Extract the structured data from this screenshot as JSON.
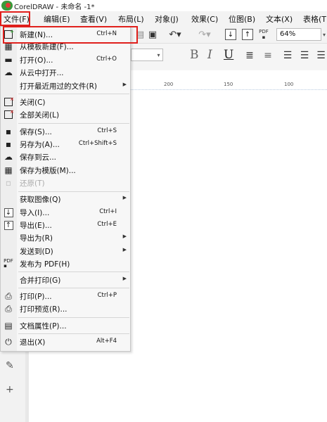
{
  "window": {
    "title": "CorelDRAW - 未命名 -1*"
  },
  "menubar": {
    "items": [
      "文件(F)",
      "编辑(E)",
      "查看(V)",
      "布局(L)",
      "对象(J)",
      "效果(C)",
      "位图(B)",
      "文本(X)",
      "表格(T)"
    ]
  },
  "toolbar": {
    "zoom": "64%",
    "pdf_label": "PDF"
  },
  "ruler": {
    "ticks": [
      "200",
      "150",
      "100"
    ]
  },
  "file_menu": {
    "items": [
      {
        "label": "新建(N)...",
        "shortcut": "Ctrl+N",
        "icon": "new-document-icon"
      },
      {
        "label": "从模板新建(F)...",
        "shortcut": "",
        "icon": "new-from-template-icon"
      },
      {
        "label": "打开(O)...",
        "shortcut": "Ctrl+O",
        "icon": "open-folder-icon"
      },
      {
        "label": "从云中打开...",
        "shortcut": "",
        "icon": "cloud-open-icon"
      },
      {
        "label": "打开最近用过的文件(R)",
        "shortcut": "",
        "icon": ""
      },
      {
        "label": "关闭(C)",
        "shortcut": "",
        "icon": "close-document-icon"
      },
      {
        "label": "全部关闭(L)",
        "shortcut": "",
        "icon": "close-all-icon"
      },
      {
        "label": "保存(S)...",
        "shortcut": "Ctrl+S",
        "icon": "save-icon"
      },
      {
        "label": "另存为(A)...",
        "shortcut": "Ctrl+Shift+S",
        "icon": "save-as-icon"
      },
      {
        "label": "保存到云...",
        "shortcut": "",
        "icon": "cloud-save-icon"
      },
      {
        "label": "保存为模版(M)...",
        "shortcut": "",
        "icon": "save-template-icon"
      },
      {
        "label": "还原(T)",
        "shortcut": "",
        "icon": "revert-icon"
      },
      {
        "label": "获取图像(Q)",
        "shortcut": "",
        "icon": ""
      },
      {
        "label": "导入(I)...",
        "shortcut": "Ctrl+I",
        "icon": "import-icon"
      },
      {
        "label": "导出(E)...",
        "shortcut": "Ctrl+E",
        "icon": "export-icon"
      },
      {
        "label": "导出为(R)",
        "shortcut": "",
        "icon": ""
      },
      {
        "label": "发送到(D)",
        "shortcut": "",
        "icon": ""
      },
      {
        "label": "发布为 PDF(H)",
        "shortcut": "",
        "icon": "publish-pdf-icon"
      },
      {
        "label": "合并打印(G)",
        "shortcut": "",
        "icon": ""
      },
      {
        "label": "打印(P)...",
        "shortcut": "Ctrl+P",
        "icon": "print-icon"
      },
      {
        "label": "打印预览(R)...",
        "shortcut": "",
        "icon": "print-preview-icon"
      },
      {
        "label": "文档属性(P)...",
        "shortcut": "",
        "icon": "document-properties-icon"
      },
      {
        "label": "退出(X)",
        "shortcut": "Alt+F4",
        "icon": "exit-power-icon"
      }
    ]
  },
  "colors": {
    "highlight": "#e0201c",
    "menu_bg": "#f7f7f7"
  }
}
